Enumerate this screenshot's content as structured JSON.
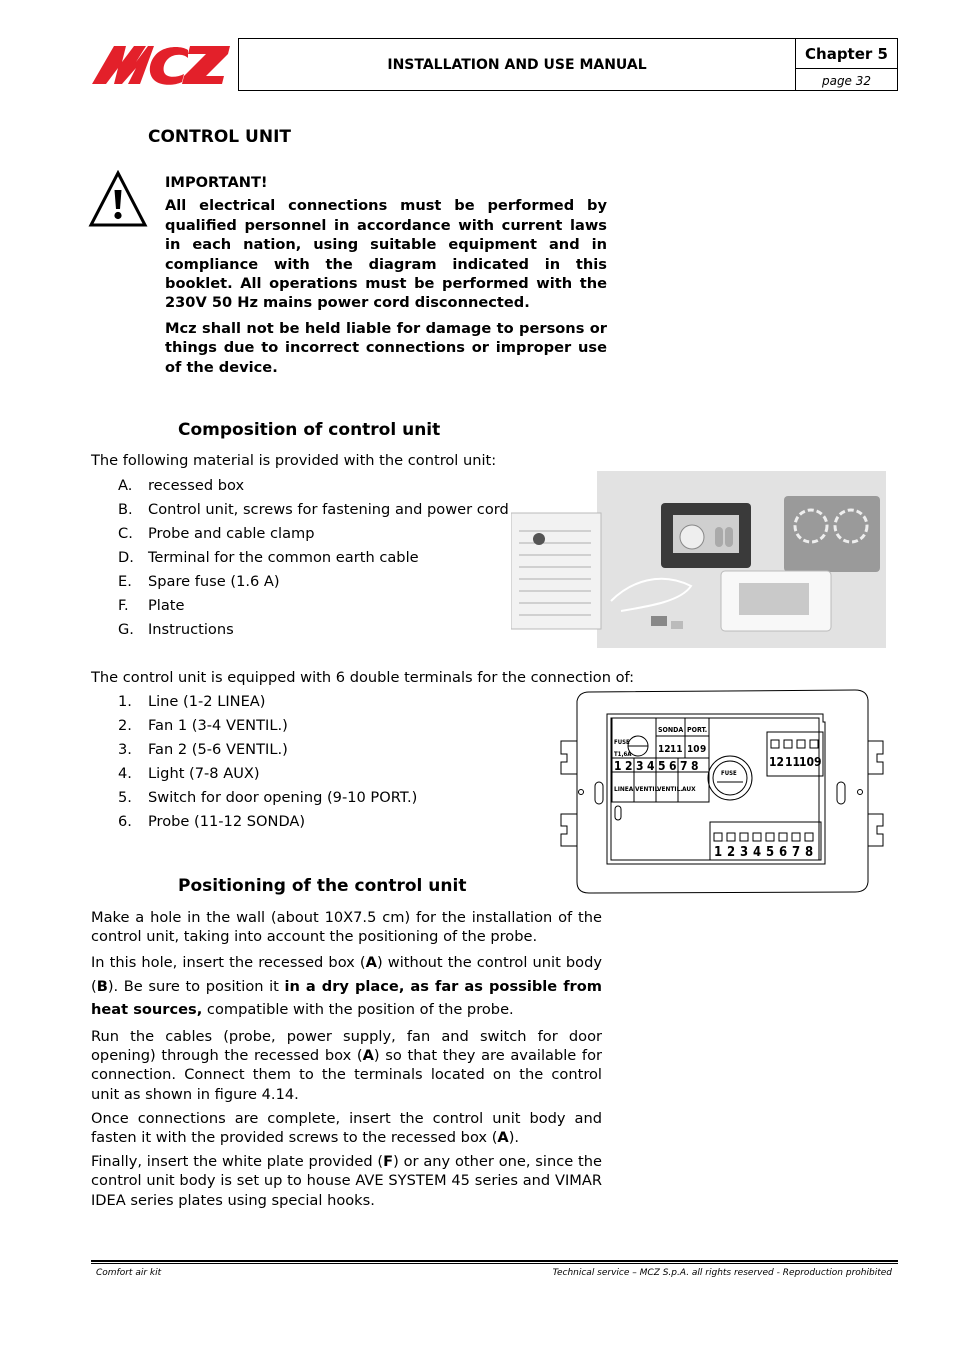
{
  "header": {
    "brand": "MCZ",
    "brand_color": "#e3202a",
    "manual_title": "INSTALLATION AND USE MANUAL",
    "chapter": "Chapter 5",
    "page": "page 32"
  },
  "section_title": "CONTROL UNIT",
  "warning": {
    "icon": "warning-triangle-icon",
    "title": "IMPORTANT!",
    "paragraphs": [
      "All electrical connections must be performed by qualified personnel in accordance with current laws in each nation, using suitable equipment and in compliance with the diagram indicated in this booklet. All operations must be performed with the 230V 50 Hz mains power cord disconnected.",
      "Mcz shall not be held liable for damage to persons or things due to incorrect connections or improper use of the device."
    ]
  },
  "composition": {
    "heading": "Composition of control unit",
    "intro": "The following material is provided with the control unit:",
    "items": [
      {
        "marker": "A.",
        "text": "recessed box"
      },
      {
        "marker": "B.",
        "text": "Control unit, screws for fastening and power cord"
      },
      {
        "marker": "C.",
        "text": "Probe and cable clamp"
      },
      {
        "marker": "D.",
        "text": "Terminal for the common earth cable"
      },
      {
        "marker": "E.",
        "text": "Spare fuse (1.6 A)"
      },
      {
        "marker": "F.",
        "text": "Plate"
      },
      {
        "marker": "G.",
        "text": "Instructions"
      }
    ],
    "photo_label": "Kit contents photo"
  },
  "terminals": {
    "intro": "The control unit is equipped with 6 double terminals for the connection of:",
    "items": [
      {
        "marker": "1.",
        "text": "Line (1-2 LINEA)"
      },
      {
        "marker": "2.",
        "text": "Fan 1 (3-4 VENTIL.)"
      },
      {
        "marker": "3.",
        "text": "Fan 2 (5-6 VENTIL.)"
      },
      {
        "marker": "4.",
        "text": "Light (7-8 AUX)"
      },
      {
        "marker": "5.",
        "text": "Switch for door opening (9-10 PORT.)"
      },
      {
        "marker": "6.",
        "text": "Probe (11-12 SONDA)"
      }
    ],
    "diagram": {
      "top_labels": [
        "SONDA",
        "PORT."
      ],
      "top_numbers": [
        "12",
        "11",
        "10",
        "9"
      ],
      "fuse_label": "FUSE",
      "fuse_rating": "T1,6A",
      "bottom_numbers": [
        "1",
        "2",
        "3",
        "4",
        "5",
        "6",
        "7",
        "8"
      ],
      "bottom_labels": [
        "LINEA",
        "VENTIL.",
        "VENTIL.",
        "AUX"
      ],
      "fuse_holder_label": "FUSE",
      "right_top_numbers": [
        "12",
        "11",
        "10",
        "9"
      ],
      "right_bottom_numbers": [
        "1",
        "2",
        "3",
        "4",
        "5",
        "6",
        "7",
        "8"
      ]
    }
  },
  "positioning": {
    "heading": "Positioning of the control unit",
    "p1": "Make a hole in the wall (about 10X7.5 cm)  for the installation of the control unit, taking into account the positioning of the probe.",
    "p2_a": "In this hole,  insert the recessed box (",
    "p2_b": "A",
    "p2_c": ") without the control unit body (",
    "p2_d": "B",
    "p2_e": ").  Be sure to position it ",
    "p2_f": "in a dry place, as far as possible from heat sources,",
    "p2_g": " compatible with the position of the probe.",
    "p3_a": "Run the cables (probe, power supply, fan and switch for door opening) through the recessed box (",
    "p3_b": "A",
    "p3_c": ") so that they are available for connection. Connect them to the terminals located on the control unit as shown in figure 4.14.",
    "p4_a": "Once connections are complete, insert the control unit body and fasten it with the provided screws to the recessed box (",
    "p4_b": "A",
    "p4_c": ").",
    "p5_a": "Finally, insert the white plate provided (",
    "p5_b": "F",
    "p5_c": ") or any other one, since the control unit body is set up to house AVE SYSTEM 45 series and VIMAR IDEA series plates using special hooks."
  },
  "footer": {
    "left": "Comfort air kit",
    "right": "Technical service – MCZ S.p.A. all rights reserved - Reproduction prohibited"
  }
}
